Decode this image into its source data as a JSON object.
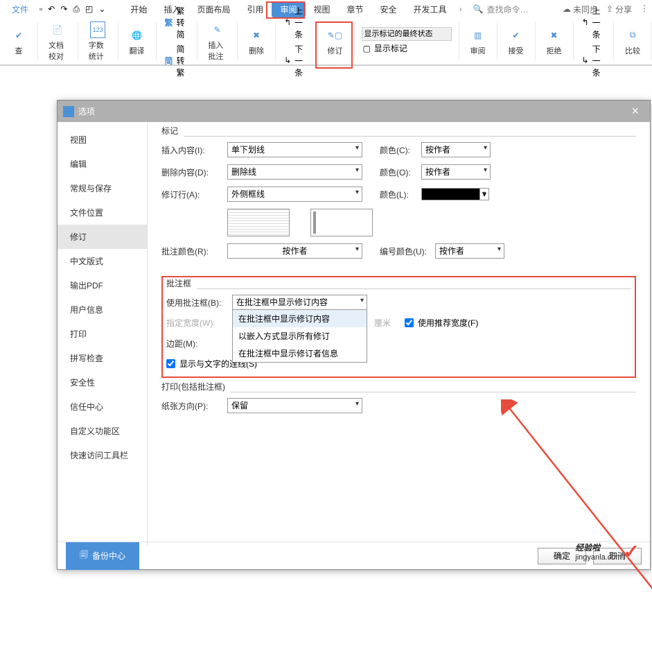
{
  "menu": {
    "file": "文件",
    "items": [
      "开始",
      "插入",
      "页面布局",
      "引用",
      "审阅",
      "视图",
      "章节",
      "安全",
      "开发工具"
    ],
    "search_placeholder": "查找命令…",
    "unsync": "未同步",
    "share": "分享"
  },
  "ribbon": {
    "check": "查",
    "doc_proof": "文档校对",
    "word_count": "字数统计",
    "translate": "翻译",
    "fan_to_simp": "繁转简",
    "simp_to_fan": "简转繁",
    "fan_label": "繁",
    "simp_label": "简",
    "insert_comment": "插入批注",
    "delete": "删除",
    "prev": "上一条",
    "next": "下一条",
    "revision": "修订",
    "show_markup_state": "显示标记的最终状态",
    "show_markup": "显示标记",
    "review_pane": "审阅",
    "accept": "接受",
    "reject": "拒绝",
    "rprev": "上一条",
    "rnext": "下一条",
    "compare": "比较"
  },
  "dialog": {
    "title": "选项",
    "sidebar": [
      "视图",
      "编辑",
      "常规与保存",
      "文件位置",
      "修订",
      "中文版式",
      "输出PDF",
      "用户信息",
      "打印",
      "拼写检查",
      "安全性",
      "信任中心",
      "自定义功能区",
      "快速访问工具栏"
    ],
    "markup": {
      "legend": "标记",
      "insert_label": "插入内容(I):",
      "insert_value": "单下划线",
      "delete_label": "删除内容(D):",
      "delete_value": "删除线",
      "revise_line_label": "修订行(A):",
      "revise_line_value": "外侧框线",
      "color_c": "颜色(C):",
      "color_o": "颜色(O):",
      "color_l": "颜色(L):",
      "by_author": "按作者",
      "comment_color_label": "批注颜色(R):",
      "comment_color_value": "按作者",
      "number_color_label": "编号颜色(U):",
      "number_color_value": "按作者"
    },
    "balloon": {
      "legend": "批注框",
      "use_label": "使用批注框(B):",
      "use_value": "在批注框中显示修订内容",
      "options": [
        "在批注框中显示修订内容",
        "以嵌入方式显示所有修订",
        "在批注框中显示修订者信息"
      ],
      "width_label": "指定宽度(W):",
      "unit": "厘米",
      "use_rec_width": "使用推荐宽度(F)",
      "margin_label": "边距(M):",
      "show_lines": "显示与文字的连线(S)"
    },
    "print": {
      "legend": "打印(包括批注框)",
      "orientation_label": "纸张方向(P):",
      "orientation_value": "保留"
    },
    "backup": "备份中心",
    "ok": "确定",
    "cancel": "取消"
  },
  "watermark": {
    "main": "经验啦",
    "sub": "jingyanla.com"
  }
}
